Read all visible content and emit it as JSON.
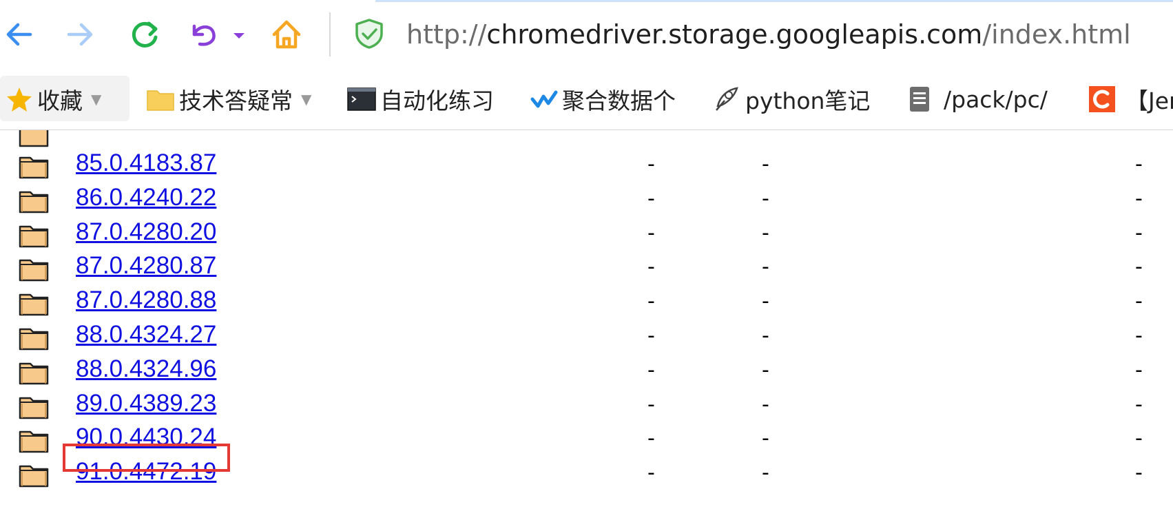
{
  "browser": {
    "url_scheme": "http://",
    "url_host": "chromedriver.storage.googleapis.com",
    "url_path": "/index.html",
    "colors": {
      "back": "#3b8ef0",
      "forward": "#a9cdf7",
      "reload": "#22b24c",
      "undo": "#8b3fd9",
      "home": "#f5a623",
      "shield": "#4caf50"
    }
  },
  "bookmarks": [
    {
      "label": "收藏",
      "icon": "star-icon",
      "has_caret": true
    },
    {
      "label": "技术答疑常",
      "icon": "folder-icon",
      "has_caret": true
    },
    {
      "label": "自动化练习",
      "icon": "terminal-icon",
      "has_caret": false
    },
    {
      "label": "聚合数据个",
      "icon": "checkmark-wave-icon",
      "has_caret": false
    },
    {
      "label": "python笔记",
      "icon": "quill-icon",
      "has_caret": false
    },
    {
      "label": "/pack/pc/",
      "icon": "document-icon",
      "has_caret": false
    },
    {
      "label": "【Jen",
      "icon": "csdn-icon",
      "has_caret": false
    }
  ],
  "listing": {
    "rows": [
      {
        "name": "85.0.4183.87",
        "col1": "-",
        "col2": "-",
        "col3": "-"
      },
      {
        "name": "86.0.4240.22",
        "col1": "-",
        "col2": "-",
        "col3": "-"
      },
      {
        "name": "87.0.4280.20",
        "col1": "-",
        "col2": "-",
        "col3": "-"
      },
      {
        "name": "87.0.4280.87",
        "col1": "-",
        "col2": "-",
        "col3": "-"
      },
      {
        "name": "87.0.4280.88",
        "col1": "-",
        "col2": "-",
        "col3": "-"
      },
      {
        "name": "88.0.4324.27",
        "col1": "-",
        "col2": "-",
        "col3": "-"
      },
      {
        "name": "88.0.4324.96",
        "col1": "-",
        "col2": "-",
        "col3": "-"
      },
      {
        "name": "89.0.4389.23",
        "col1": "-",
        "col2": "-",
        "col3": "-"
      },
      {
        "name": "90.0.4430.24",
        "col1": "-",
        "col2": "-",
        "col3": "-",
        "highlighted": true
      },
      {
        "name": "91.0.4472.19",
        "col1": "-",
        "col2": "-",
        "col3": "-"
      }
    ],
    "highlight_color": "#e53935",
    "link_color": "#1010e0"
  }
}
